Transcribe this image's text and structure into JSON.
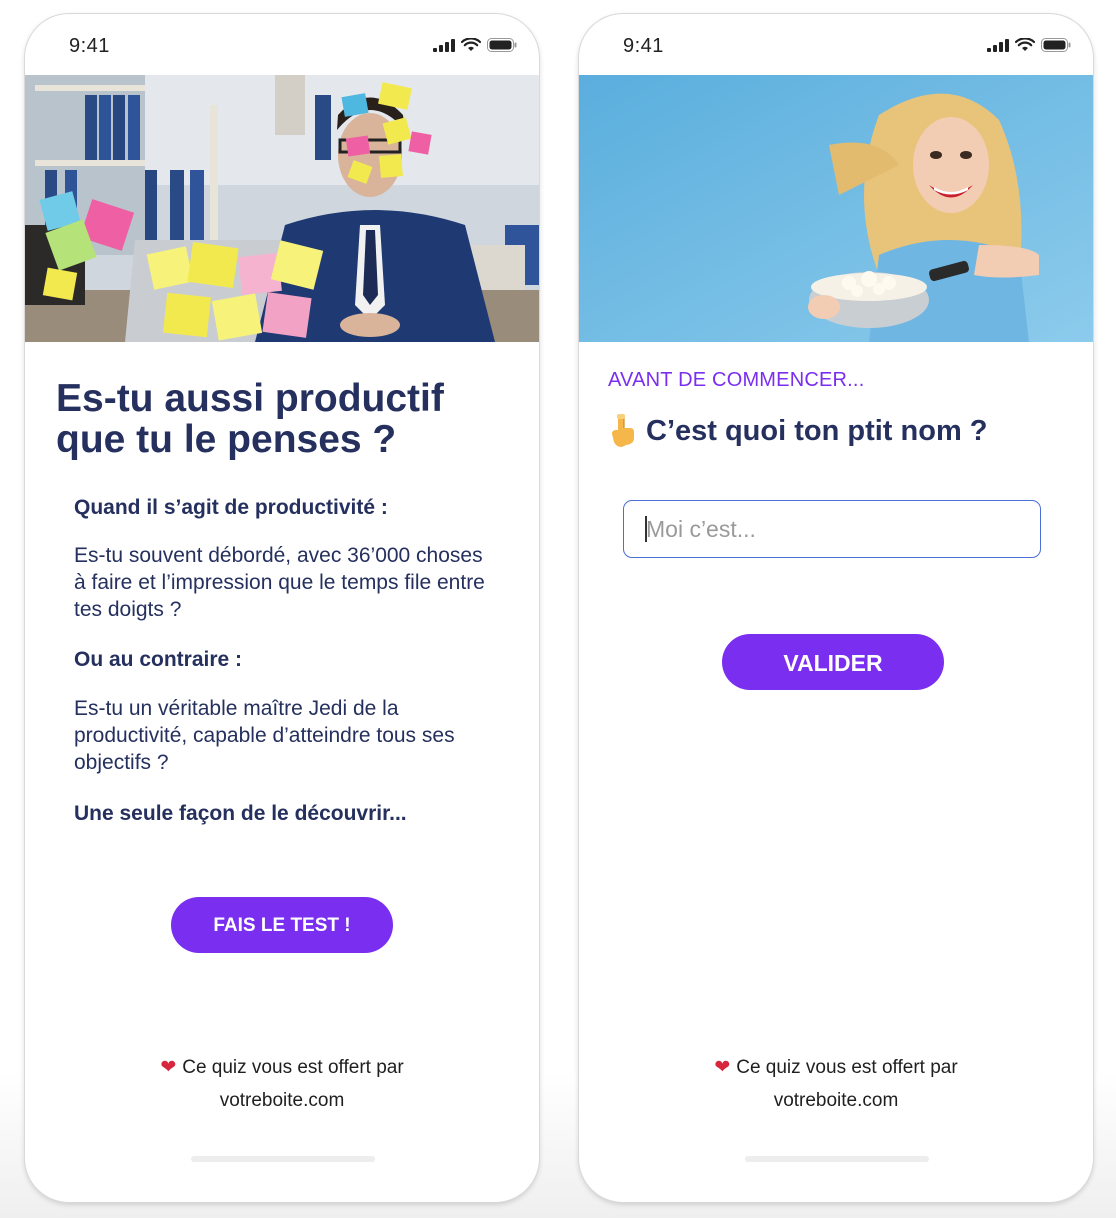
{
  "status_bar": {
    "time": "9:41"
  },
  "screen_intro": {
    "title": "Es-tu aussi productif que tu le penses ?",
    "paragraph_1": "Quand il s’agit de productivité :",
    "paragraph_2": "Es-tu souvent débordé, avec 36’000 choses à faire et l’impression que le temps file entre tes doigts ?",
    "paragraph_3": "Ou au contraire :",
    "paragraph_4": "Es-tu un véritable maître Jedi de la productivité, capable d’atteindre tous ses objectifs ?",
    "paragraph_5": "Une seule façon de le découvrir...",
    "cta_label": "FAIS LE TEST !",
    "footer_heart": "❤",
    "footer_text": "Ce quiz vous est offert par",
    "footer_site": "votreboite.com"
  },
  "screen_name": {
    "eyebrow": "AVANT DE COMMENCER...",
    "question": "C’est quoi ton ptit nom ?",
    "input_placeholder": "Moi c’est...",
    "input_value": "",
    "cta_label": "VALIDER",
    "footer_heart": "❤",
    "footer_text": "Ce quiz vous est offert par",
    "footer_site": "votreboite.com"
  },
  "colors": {
    "accent": "#7a2ef0",
    "heading": "#25305e",
    "input_border": "#4a6fd8",
    "heart": "#d7263d"
  },
  "icons": [
    "cellular-signal-icon",
    "wifi-icon",
    "battery-icon",
    "heart-icon",
    "pointing-hand-icon"
  ]
}
